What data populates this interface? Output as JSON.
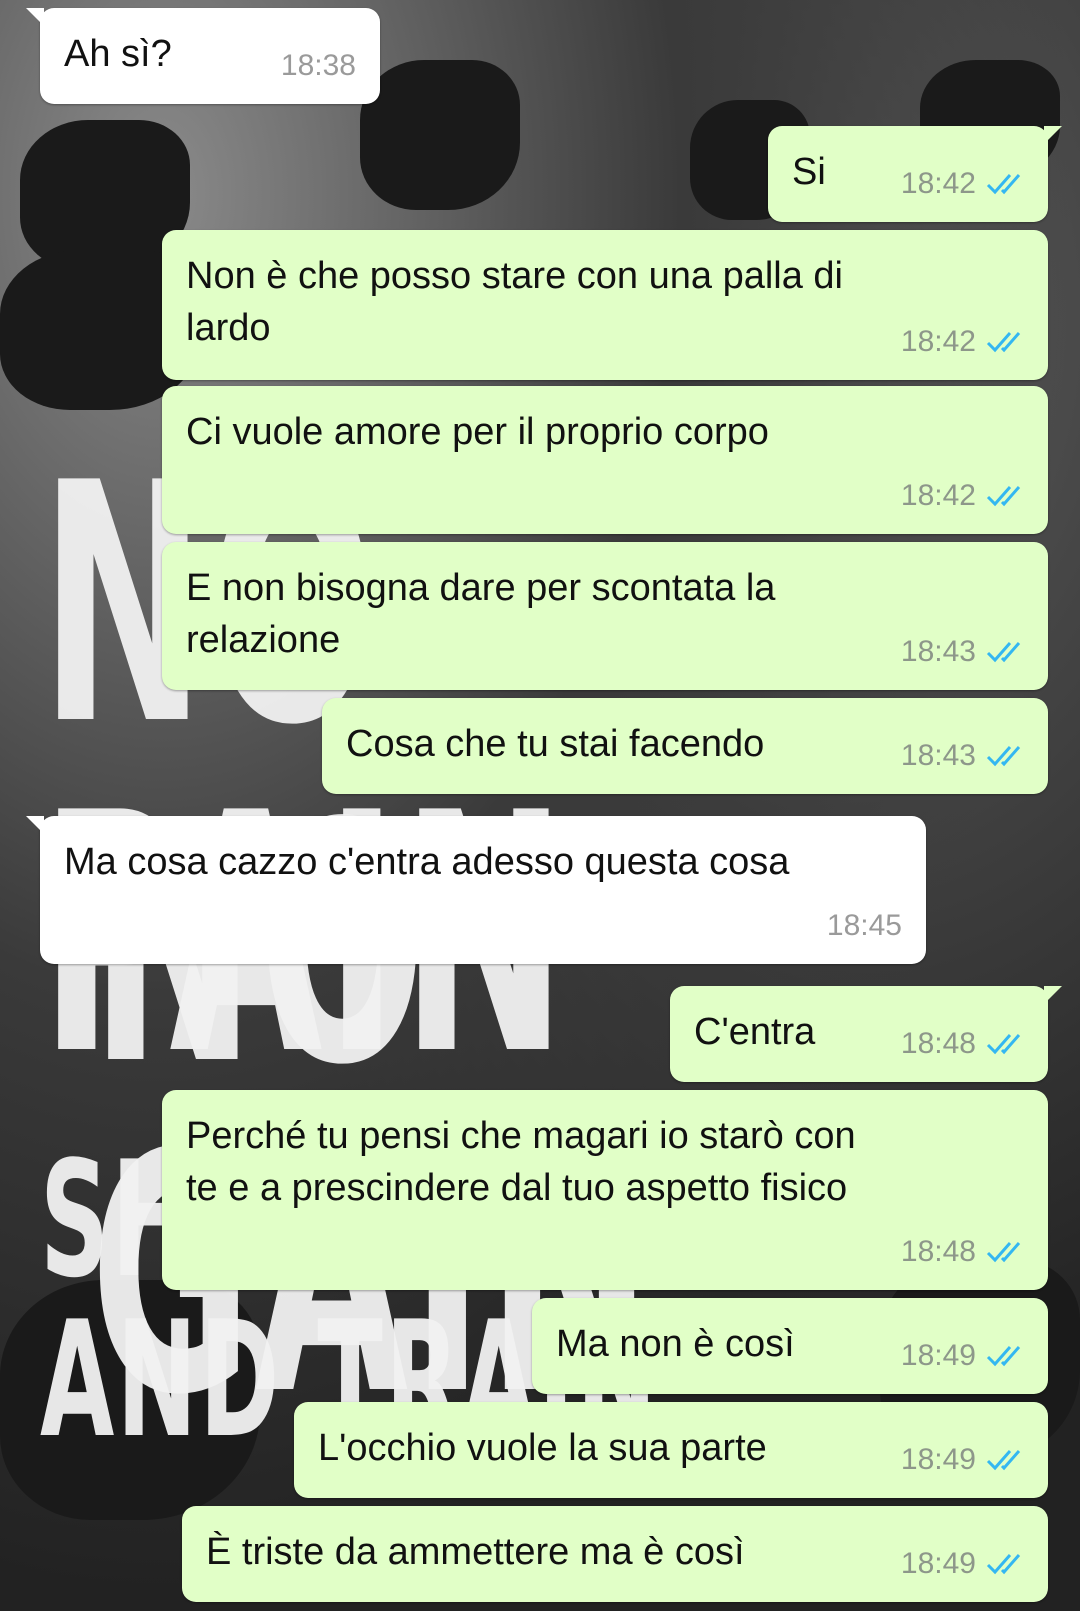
{
  "colors": {
    "incoming_bubble": "#ffffff",
    "outgoing_bubble": "#e1ffc7",
    "read_ticks": "#34b7f1",
    "timestamp": "#8d978a"
  },
  "wallpaper": {
    "lines": [
      "NO PAIN",
      "NO GAIN",
      "SHUT UP AND TRAIN"
    ]
  },
  "messages": [
    {
      "direction": "in",
      "text": "Ah sì?",
      "time": "18:38",
      "status_icon": ""
    },
    {
      "direction": "out",
      "text": "Si",
      "time": "18:42",
      "status_icon": "double-check-read-icon"
    },
    {
      "direction": "out",
      "text": "Non è che posso stare con una palla di\nlardo",
      "time": "18:42",
      "status_icon": "double-check-read-icon"
    },
    {
      "direction": "out",
      "text": "Ci vuole amore per il proprio corpo",
      "time": "18:42",
      "status_icon": "double-check-read-icon"
    },
    {
      "direction": "out",
      "text": "E non bisogna dare per scontata la\nrelazione",
      "time": "18:43",
      "status_icon": "double-check-read-icon"
    },
    {
      "direction": "out",
      "text": "Cosa che tu stai facendo",
      "time": "18:43",
      "status_icon": "double-check-read-icon"
    },
    {
      "direction": "in",
      "text": "Ma cosa cazzo c'entra adesso questa cosa",
      "time": "18:45",
      "status_icon": ""
    },
    {
      "direction": "out",
      "text": "C'entra",
      "time": "18:48",
      "status_icon": "double-check-read-icon"
    },
    {
      "direction": "out",
      "text": "Perché tu pensi che magari io starò con\nte e a prescindere dal tuo aspetto fisico",
      "time": "18:48",
      "status_icon": "double-check-read-icon"
    },
    {
      "direction": "out",
      "text": "Ma non è così",
      "time": "18:49",
      "status_icon": "double-check-read-icon"
    },
    {
      "direction": "out",
      "text": "L'occhio vuole la sua parte",
      "time": "18:49",
      "status_icon": "double-check-read-icon"
    },
    {
      "direction": "out",
      "text": "È triste da ammettere ma è così",
      "time": "18:49",
      "status_icon": "double-check-read-icon"
    }
  ]
}
